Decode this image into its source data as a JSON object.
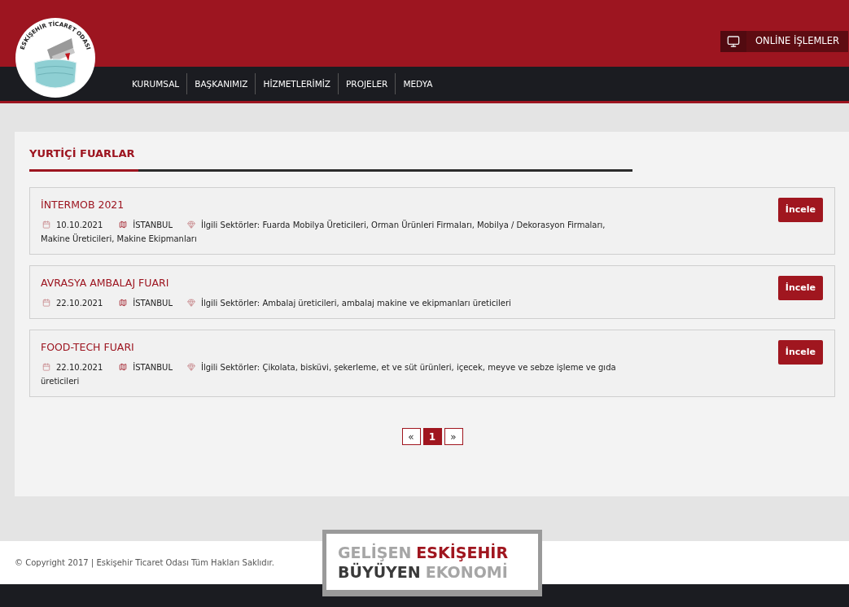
{
  "logo": {
    "text": "ESKİŞEHİR TİCARET ODASI"
  },
  "online_button": {
    "label": "ONLİNE İŞLEMLER"
  },
  "nav": [
    {
      "label": "KURUMSAL"
    },
    {
      "label": "BAŞKANIMIZ"
    },
    {
      "label": "HİZMETLERİMİZ"
    },
    {
      "label": "PROJELER"
    },
    {
      "label": "MEDYA"
    }
  ],
  "section_title": "YURTİÇİ FUARLAR",
  "fairs": [
    {
      "title": "İNTERMOB 2021",
      "date": "10.10.2021",
      "city": "İSTANBUL",
      "sectors": "İlgili Sektörler: Fuarda Mobilya Üreticileri, Orman Ürünleri Firmaları, Mobilya / Dekorasyon Firmaları, Makine Üreticileri, Makine Ekipmanları",
      "button": "İncele"
    },
    {
      "title": "AVRASYA AMBALAJ FUARI",
      "date": "22.10.2021",
      "city": "İSTANBUL",
      "sectors": "İlgili Sektörler: Ambalaj üreticileri, ambalaj makine ve ekipmanları üreticileri",
      "button": "İncele"
    },
    {
      "title": "FOOD-TECH FUARI",
      "date": "22.10.2021",
      "city": "İSTANBUL",
      "sectors": "İlgili Sektörler: Çikolata, bisküvi, şekerleme, et ve süt ürünleri, içecek, meyve ve sebze işleme ve gıda üreticileri",
      "button": "İncele"
    }
  ],
  "pagination": [
    {
      "label": "«",
      "selected": false
    },
    {
      "label": "1",
      "selected": true
    },
    {
      "label": "»",
      "selected": false
    }
  ],
  "footer": {
    "copyright": "© Copyright 2017 | Eskişehir Ticaret Odası Tüm Hakları Saklıdır."
  },
  "banner": [
    [
      {
        "text": "GELİŞEN",
        "color": "#a6a6a6"
      },
      {
        "text": "ESKİŞEHİR",
        "color": "#a0161f"
      }
    ],
    [
      {
        "text": "BÜYÜYEN",
        "color": "#3a3a3a"
      },
      {
        "text": "EKONOMİ",
        "color": "#a6a6a6"
      }
    ]
  ]
}
